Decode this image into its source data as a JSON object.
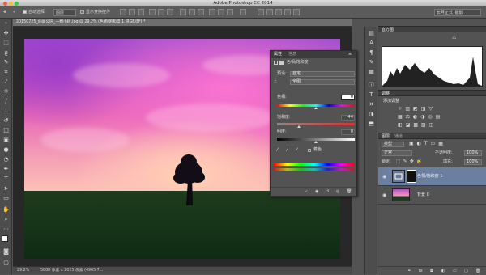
{
  "window": {
    "title": "Adobe Photoshop CC 2014"
  },
  "options_bar": {
    "auto_select_label": "自动选择:",
    "auto_select_value": "图层",
    "show_transform_label": "显示变换控件",
    "workspace": "长月正式_摄影"
  },
  "document": {
    "tab_title": "20150725_仙尚公园_一棵小树.jpg @ 29.2% (色相/饱和度 1, RGB/8*) *",
    "zoom": "29.2%",
    "doc_info": "5888 像素 x 2025 像素 (4965.7..."
  },
  "properties": {
    "tab_properties": "属性",
    "tab_info": "信息",
    "adjustment_title": "色相/饱和度",
    "preset_label": "预设:",
    "preset_value": "自定",
    "channel_value": "全图",
    "hue_label": "色相:",
    "hue_value": "0",
    "saturation_label": "饱和度:",
    "saturation_value": "-44",
    "lightness_label": "明度:",
    "lightness_value": "0",
    "colorize_label": "着色"
  },
  "panels": {
    "histogram_title": "直方图",
    "adjustments_title": "调整",
    "add_adjustment_label": "添加调整",
    "layers_tab": "图层",
    "channels_tab": "通道",
    "kind_filter": "类型",
    "blend_mode": "正常",
    "opacity_label": "不透明度:",
    "opacity_value": "100%",
    "lock_label": "锁定:",
    "fill_label": "填充:",
    "fill_value": "100%",
    "layers": [
      {
        "name": "色相/饱和度 1"
      },
      {
        "name": "背景 0"
      }
    ]
  },
  "colors": {
    "accent": "#4a78c4",
    "panel": "#535353",
    "dark": "#282828"
  }
}
